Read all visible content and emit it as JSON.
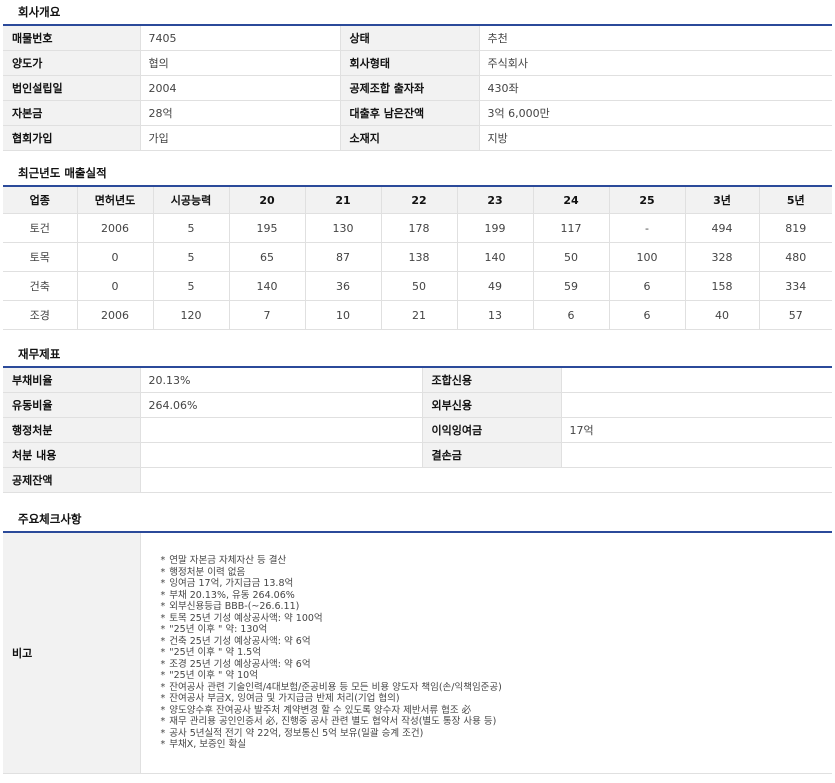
{
  "overview": {
    "title": "회사개요",
    "rows": [
      [
        {
          "k": "매물번호",
          "v": "7405"
        },
        {
          "k": "상태",
          "v": "추천"
        }
      ],
      [
        {
          "k": "양도가",
          "v": "협의"
        },
        {
          "k": "회사형태",
          "v": "주식회사"
        }
      ],
      [
        {
          "k": "법인설립일",
          "v": "2004"
        },
        {
          "k": "공제조합 출자좌",
          "v": "430좌"
        }
      ],
      [
        {
          "k": "자본금",
          "v": "28억"
        },
        {
          "k": "대출후 남은잔액",
          "v": "3억 6,000만"
        }
      ],
      [
        {
          "k": "협회가입",
          "v": "가입"
        },
        {
          "k": "소재지",
          "v": "지방"
        }
      ]
    ]
  },
  "sales": {
    "title": "최근년도 매출실적",
    "headers": [
      "업종",
      "면허년도",
      "시공능력",
      "20",
      "21",
      "22",
      "23",
      "24",
      "25",
      "3년",
      "5년"
    ],
    "rows": [
      [
        "토건",
        "2006",
        "5",
        "195",
        "130",
        "178",
        "199",
        "117",
        "-",
        "494",
        "819"
      ],
      [
        "토목",
        "0",
        "5",
        "65",
        "87",
        "138",
        "140",
        "50",
        "100",
        "328",
        "480"
      ],
      [
        "건축",
        "0",
        "5",
        "140",
        "36",
        "50",
        "49",
        "59",
        "6",
        "158",
        "334"
      ],
      [
        "조경",
        "2006",
        "120",
        "7",
        "10",
        "21",
        "13",
        "6",
        "6",
        "40",
        "57"
      ]
    ]
  },
  "finance": {
    "title": "재무제표",
    "rows": [
      [
        {
          "k": "부채비율",
          "v": "20.13%"
        },
        {
          "k": "조합신용",
          "v": ""
        }
      ],
      [
        {
          "k": "유동비율",
          "v": "264.06%"
        },
        {
          "k": "외부신용",
          "v": ""
        }
      ],
      [
        {
          "k": "행정처분",
          "v": ""
        },
        {
          "k": "이익잉여금",
          "v": "17억"
        }
      ],
      [
        {
          "k": "처분 내용",
          "v": ""
        },
        {
          "k": "결손금",
          "v": ""
        }
      ]
    ],
    "last_row": {
      "k": "공제잔액",
      "v": ""
    }
  },
  "check": {
    "title": "주요체크사항",
    "label": "비고",
    "bullet": "*",
    "notes": [
      "연말 자본금 자체자산 등 결산",
      "행정처분 이력 없음",
      "잉여금 17억, 가지급금 13.8억",
      "부채 20.13%,  유동 264.06%",
      "외부신용등급 BBB-(~26.6.11)",
      "토목 25년 기성 예상공사액: 약 100억",
      "\"25년 이후 \" 약: 130억",
      "건축 25년 기성 예상공사액: 약 6억",
      "\"25년 이후 \" 약 1.5억",
      "조경 25년 기성 예상공사액: 약 6억",
      "\"25년 이후 \" 약 10억",
      "잔여공사 관련 기술인력/4대보험/준공비용 등 모든 비용 양도자 책임(손/익책임준공)",
      "잔여공사 부금X, 잉여금 및 가지급금 반제 처리(기업 협의)",
      "양도양수후 잔여공사 발주처 계약변경 할 수 있도록 양수자 제반서류 협조 必",
      "재무 관리용 공인인증서 必, 진행중 공사 관련 별도 협약서 작성(별도 통장 사용 등)",
      "공사 5년실적 전기 약 22억, 정보통신 5억 보유(일괄 승계 조건)",
      "부채X, 보증인 확실"
    ]
  }
}
